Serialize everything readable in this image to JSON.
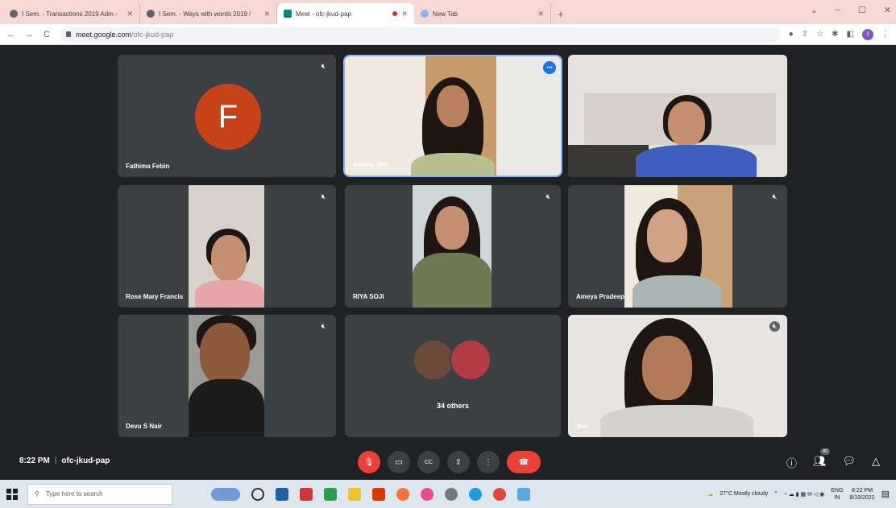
{
  "browser": {
    "tabs": [
      {
        "label": "I Sem. - Transactions 2019 Adm -",
        "active": false
      },
      {
        "label": "I Sem. - Ways with words 2019 /",
        "active": false
      },
      {
        "label": "Meet - ofc-jkud-pap",
        "active": true,
        "recording": true
      },
      {
        "label": "New Tab",
        "active": false
      }
    ],
    "new_tab_symbol": "+",
    "window_controls": {
      "dropdown": "⌄",
      "minimize": "–",
      "maximize": "☐",
      "close": "✕"
    },
    "nav": {
      "back": "←",
      "forward": "→",
      "reload": "C"
    },
    "url_host": "meet.google.com",
    "url_path": "/ofc-jkud-pap",
    "profile_initial": "I"
  },
  "participants": [
    {
      "name": "Fathima Febin",
      "avatar_letter": "F",
      "muted": true
    },
    {
      "name": "Aleena Jiny",
      "speaking": true
    },
    {
      "name": ""
    },
    {
      "name": "Rose Mary Francis",
      "muted": true
    },
    {
      "name": "RIYA SOJI",
      "muted": true
    },
    {
      "name": "Ameya Pradeep",
      "muted": true
    },
    {
      "name": "Devu S Nair",
      "muted": true
    },
    {
      "name": "",
      "others_label": "34 others"
    },
    {
      "name": "You",
      "muted": true
    }
  ],
  "meeting": {
    "time": "8:22 PM",
    "separator": "|",
    "code": "ofc-jkud-pap",
    "participant_count": "40"
  },
  "controls": {
    "mic": "🎙",
    "camera": "▭",
    "captions": "CC",
    "present": "⇪",
    "more": "⋮",
    "leave": "☎"
  },
  "taskbar": {
    "search_placeholder": "Type here to search",
    "weather": "27°C  Mostly cloudy",
    "lang": "ENG",
    "lang_region": "IN",
    "time": "8:22 PM",
    "date": "8/19/2022"
  },
  "colors": {
    "meet_bg": "#202124",
    "tile_bg": "#3c4043",
    "red": "#ea4335",
    "avatar_orange": "#c8431a"
  }
}
